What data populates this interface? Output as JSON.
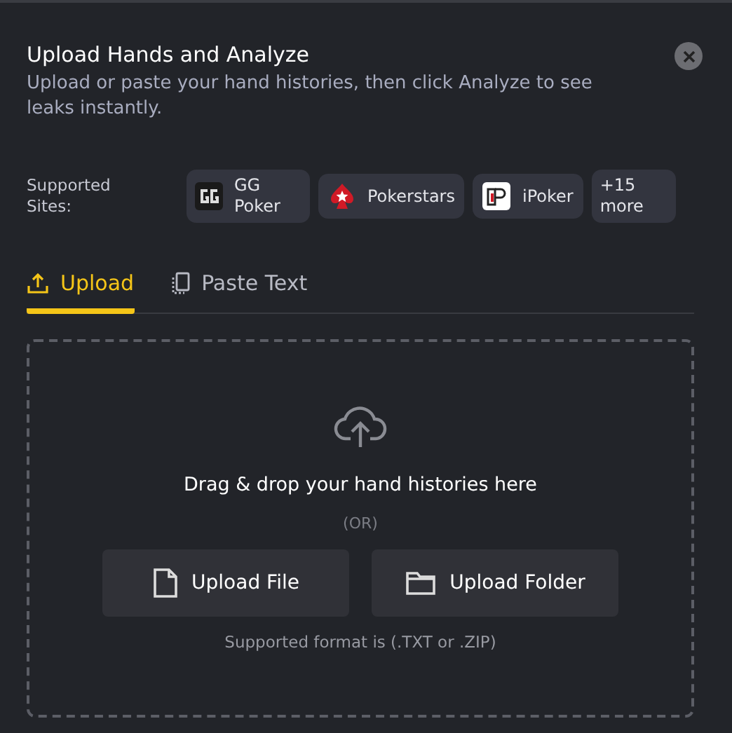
{
  "dialog": {
    "title": "Upload Hands and Analyze",
    "subtitle": "Upload or paste your hand histories, then click Analyze to see leaks instantly."
  },
  "supported_sites": {
    "label": "Supported Sites:",
    "sites": [
      {
        "name": "GG Poker",
        "kind": "gg"
      },
      {
        "name": "Pokerstars",
        "kind": "stars"
      },
      {
        "name": "iPoker",
        "kind": "ipoker"
      },
      {
        "name": "+15 more",
        "kind": "more"
      }
    ]
  },
  "tabs": [
    {
      "label": "Upload",
      "kind": "upload",
      "selected": true
    },
    {
      "label": "Paste Text",
      "kind": "paste",
      "selected": false
    }
  ],
  "dropzone": {
    "prompt": "Drag & drop your hand histories here",
    "separator": "(OR)",
    "buttons": [
      {
        "label": "Upload File",
        "kind": "file"
      },
      {
        "label": "Upload Folder",
        "kind": "folder"
      }
    ],
    "note": "Supported format is (.TXT or .ZIP)"
  }
}
